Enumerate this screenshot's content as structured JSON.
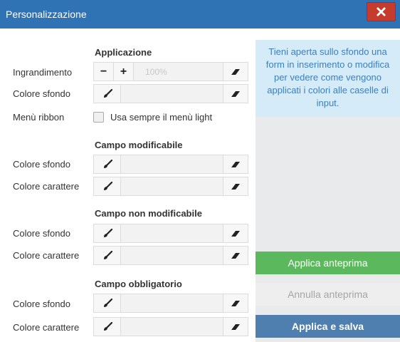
{
  "window": {
    "title": "Personalizzazione"
  },
  "sections": {
    "applicazione": "Applicazione",
    "campo_modificabile": "Campo modificabile",
    "campo_non_modificabile": "Campo non modificabile",
    "campo_obbligatorio": "Campo obbligatorio"
  },
  "labels": {
    "ingrandimento": "Ingrandimento",
    "colore_sfondo": "Colore sfondo",
    "menu_ribbon": "Menù ribbon",
    "colore_carattere": "Colore carattere"
  },
  "zoom": {
    "minus": "−",
    "plus": "+",
    "value": "100%"
  },
  "ribbon_checkbox": {
    "label": "Usa sempre il menù light",
    "checked": false
  },
  "info_text": "Tieni aperta sullo sfondo una form in inserimento o modifica per vedere come vengono applicati i colori alle caselle di input.",
  "buttons": {
    "preview": "Applica anteprima",
    "cancel_preview": "Annulla anteprima",
    "apply_save": "Applica e salva"
  },
  "colors": {
    "titlebar": "#2f73b5",
    "close": "#c53c2f",
    "preview": "#5cb85c",
    "save": "#4e7fae",
    "info_bg": "#d6ebf8"
  }
}
